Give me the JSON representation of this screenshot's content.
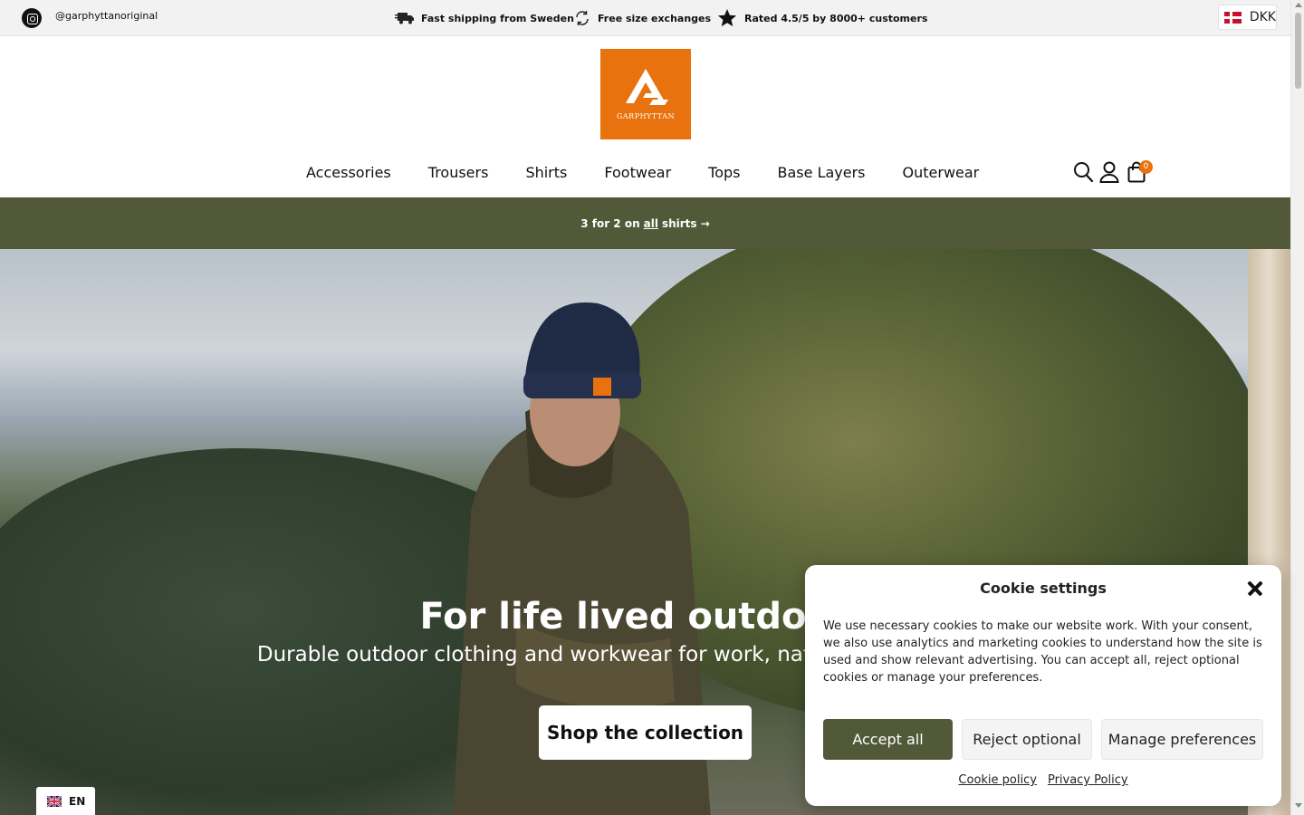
{
  "topbar": {
    "instagram_handle": "@garphyttanoriginal",
    "usps": [
      {
        "icon": "truck-icon",
        "text": "Fast shipping from Sweden"
      },
      {
        "icon": "exchange-icon",
        "text": "Free size exchanges"
      },
      {
        "icon": "star-icon",
        "text": "Rated 4.5/5 by 8000+ customers"
      }
    ],
    "currency": "DKK"
  },
  "header": {
    "logo_text": "GARPHYTTAN",
    "nav": [
      "Accessories",
      "Trousers",
      "Shirts",
      "Footwear",
      "Tops",
      "Base Layers",
      "Outerwear"
    ],
    "cart_count": "0"
  },
  "promo": {
    "prefix": "3 for 2 on",
    "highlight": "all",
    "suffix": "shirts →"
  },
  "hero": {
    "title": "For life lived outdoors",
    "subtitle": "Durable outdoor clothing and workwear for work, nature and everyday life",
    "cta": "Shop the collection"
  },
  "language": "EN",
  "cookie": {
    "title": "Cookie settings",
    "text": "We use necessary cookies to make our website work. With your consent, we also use analytics and marketing cookies to understand how the site is used and show relevant advertising. You can accept all, reject optional cookies or manage your preferences.",
    "accept": "Accept all",
    "reject": "Reject optional",
    "manage": "Manage preferences",
    "links": [
      "Cookie policy",
      "Privacy Policy"
    ]
  },
  "colors": {
    "brand_orange": "#e8730e",
    "olive": "#525939"
  }
}
